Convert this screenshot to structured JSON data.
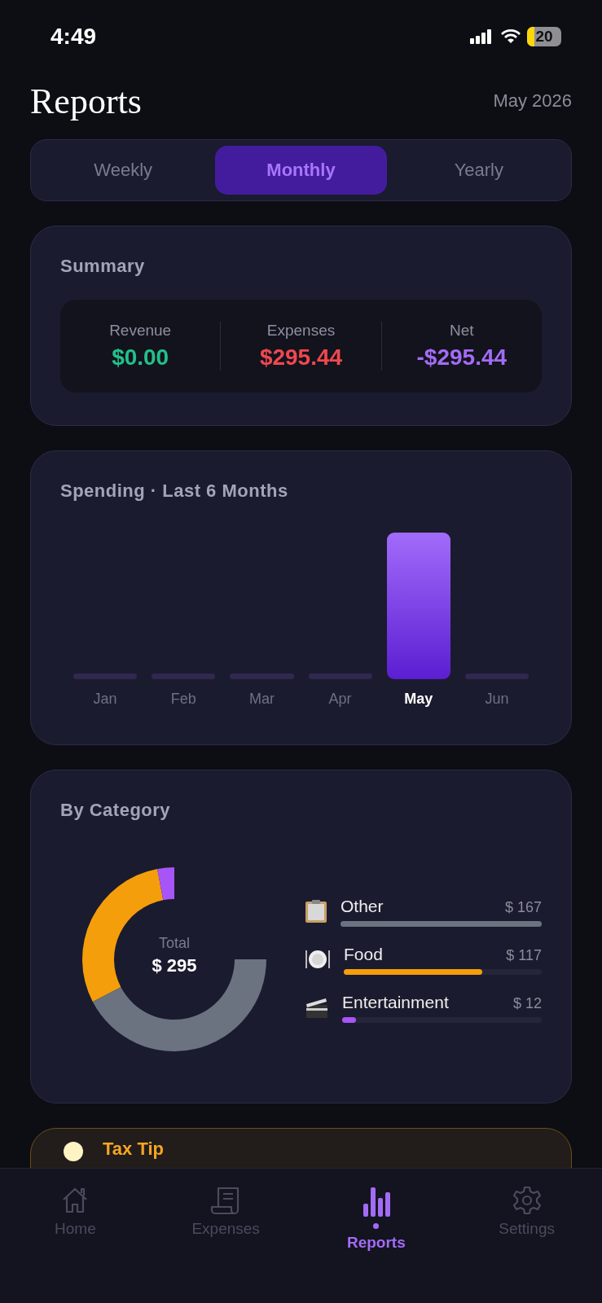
{
  "status_bar": {
    "time": "4:49",
    "battery": "20"
  },
  "header": {
    "title": "Reports",
    "period": "May 2026"
  },
  "tabs": [
    {
      "label": "Weekly",
      "selected": false
    },
    {
      "label": "Monthly",
      "selected": true
    },
    {
      "label": "Yearly",
      "selected": false
    }
  ],
  "summary": {
    "title": "Summary",
    "metrics": [
      {
        "label": "Revenue",
        "value": "$0.00",
        "color": "#22c08a"
      },
      {
        "label": "Expenses",
        "value": "$295.44",
        "color": "#f0474f"
      },
      {
        "label": "Net",
        "value": "-$295.44",
        "color": "#a36bf5"
      }
    ]
  },
  "spending": {
    "title": "Spending · Last 6 Months",
    "months": [
      {
        "label": "Jan",
        "selected": false
      },
      {
        "label": "Feb",
        "selected": false
      },
      {
        "label": "Mar",
        "selected": false
      },
      {
        "label": "Apr",
        "selected": false
      },
      {
        "label": "May",
        "selected": true
      },
      {
        "label": "Jun",
        "selected": false
      }
    ]
  },
  "categories": {
    "title": "By Category",
    "total_label": "Total",
    "total": "$ 295",
    "items": [
      {
        "kind": "clipboard",
        "name": "Other",
        "amount": "$ 167",
        "level": 1,
        "color": "#6b7280"
      },
      {
        "kind": "plate",
        "name": "Food",
        "amount": "$ 117",
        "level": 0.7,
        "color": "#f59e0b"
      },
      {
        "kind": "clapper",
        "name": "Entertainment",
        "amount": "$ 12",
        "level": 0.07,
        "color": "#a855f7"
      }
    ]
  },
  "tip": {
    "title": "Tax Tip"
  },
  "nav": [
    {
      "kind": "home",
      "label": "Home",
      "selected": false
    },
    {
      "kind": "receipt",
      "label": "Expenses",
      "selected": false
    },
    {
      "kind": "chart",
      "label": "Reports",
      "selected": true
    },
    {
      "kind": "gear",
      "label": "Settings",
      "selected": false
    }
  ]
}
